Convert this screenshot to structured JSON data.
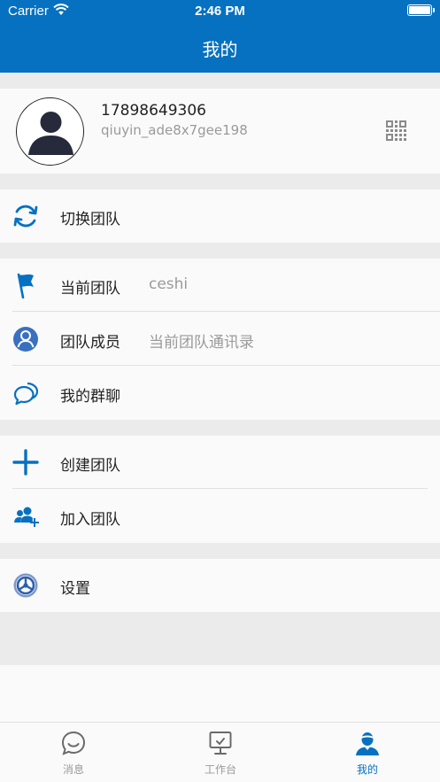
{
  "status_bar": {
    "carrier": "Carrier",
    "time": "2:46 PM"
  },
  "header": {
    "title": "我的"
  },
  "profile": {
    "phone": "17898649306",
    "username": "qiuyin_ade8x7gee198"
  },
  "menu": {
    "switch_team": {
      "label": "切换团队",
      "icon": "sync-icon"
    },
    "current_team": {
      "label": "当前团队",
      "value": "ceshi",
      "icon": "flag-icon"
    },
    "team_members": {
      "label": "团队成员",
      "value": "当前团队通讯录",
      "icon": "user-circle-icon"
    },
    "my_groups": {
      "label": "我的群聊",
      "icon": "chat-bubbles-icon"
    },
    "create_team": {
      "label": "创建团队",
      "icon": "plus-icon"
    },
    "join_team": {
      "label": "加入团队",
      "icon": "add-users-icon"
    },
    "settings": {
      "label": "设置",
      "icon": "steering-wheel-icon"
    }
  },
  "tabbar": {
    "tabs": [
      {
        "label": "消息",
        "icon": "message-icon",
        "active": false
      },
      {
        "label": "工作台",
        "icon": "workbench-icon",
        "active": false
      },
      {
        "label": "我的",
        "icon": "profile-icon",
        "active": true
      }
    ]
  },
  "colors": {
    "primary": "#0671c0",
    "background": "#ebebeb",
    "row": "#fafafa",
    "muted": "#9a9a9a"
  }
}
